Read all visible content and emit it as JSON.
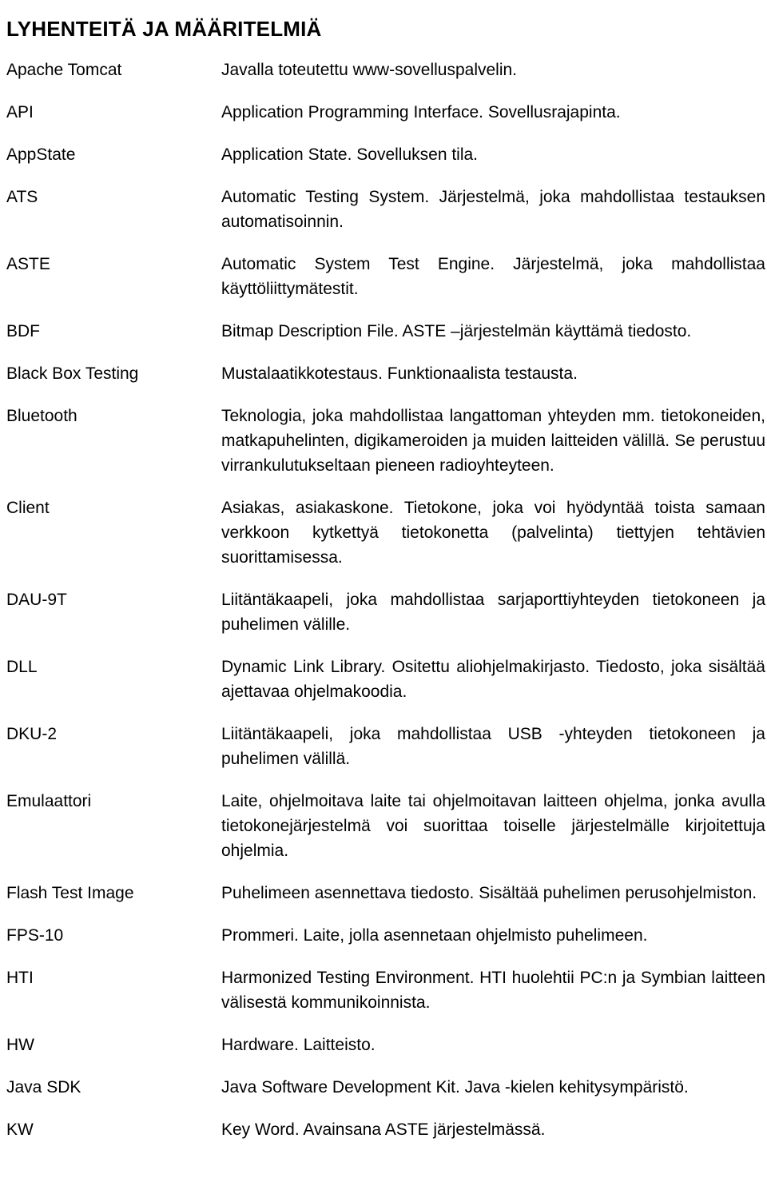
{
  "document": {
    "title": "LYHENTEITÄ JA MÄÄRITELMIÄ",
    "entries": [
      {
        "term": "Apache Tomcat",
        "definition": "Javalla toteutettu www-sovelluspalvelin.",
        "justified": false
      },
      {
        "term": "API",
        "definition": "Application Programming Interface. Sovellusrajapinta.",
        "justified": false
      },
      {
        "term": "AppState",
        "definition": "Application State. Sovelluksen tila.",
        "justified": false
      },
      {
        "term": "ATS",
        "definition": "Automatic Testing System. Järjestelmä, joka mahdollistaa testauksen automatisoinnin.",
        "justified": true
      },
      {
        "term": "ASTE",
        "definition": "Automatic System Test Engine. Järjestelmä, joka mahdollistaa käyttöliittymätestit.",
        "justified": true
      },
      {
        "term": "BDF",
        "definition": "Bitmap Description File. ASTE –järjestelmän käyttämä tiedosto.",
        "justified": false
      },
      {
        "term": "Black Box Testing",
        "definition": "Mustalaatikkotestaus. Funktionaalista testausta.",
        "justified": false
      },
      {
        "term": "Bluetooth",
        "definition": "Teknologia, joka mahdollistaa langattoman yhteyden mm. tietokoneiden, matkapuhelinten, digikameroiden ja muiden laitteiden välillä. Se perustuu virrankulutukseltaan pieneen radioyhteyteen.",
        "justified": true
      },
      {
        "term": "Client",
        "definition": "Asiakas, asiakaskone. Tietokone, joka voi hyödyntää toista samaan verkkoon kytkettyä tietokonetta (palvelinta) tiettyjen tehtävien suorittamisessa.",
        "justified": true
      },
      {
        "term": "DAU-9T",
        "definition": "Liitäntäkaapeli, joka mahdollistaa sarjaporttiyhteyden tietokoneen ja puhelimen välille.",
        "justified": true
      },
      {
        "term": "DLL",
        "definition": "Dynamic Link Library. Ositettu aliohjelmakirjasto. Tiedosto, joka sisältää ajettavaa ohjelmakoodia.",
        "justified": true
      },
      {
        "term": "DKU-2",
        "definition": "Liitäntäkaapeli, joka mahdollistaa USB -yhteyden tietokoneen ja puhelimen välillä.",
        "justified": true
      },
      {
        "term": "Emulaattori",
        "definition": "Laite, ohjelmoitava laite tai ohjelmoitavan laitteen ohjelma, jonka avulla tietokonejärjestelmä voi suorittaa toiselle järjestelmälle kirjoitettuja ohjelmia.",
        "justified": true
      },
      {
        "term": "Flash Test Image",
        "definition": "Puhelimeen asennettava tiedosto. Sisältää puhelimen perusohjelmiston.",
        "justified": true
      },
      {
        "term": "FPS-10",
        "definition": "Prommeri. Laite, jolla asennetaan ohjelmisto puhelimeen.",
        "justified": false
      },
      {
        "term": "HTI",
        "definition": "Harmonized Testing Environment. HTI huolehtii PC:n ja Symbian laitteen välisestä kommunikoinnista.",
        "justified": true
      },
      {
        "term": "HW",
        "definition": "Hardware. Laitteisto.",
        "justified": false
      },
      {
        "term": "Java SDK",
        "definition": "Java Software Development Kit. Java -kielen kehitysympäristö.",
        "justified": false
      },
      {
        "term": "KW",
        "definition": "Key Word. Avainsana ASTE järjestelmässä.",
        "justified": false
      }
    ]
  }
}
